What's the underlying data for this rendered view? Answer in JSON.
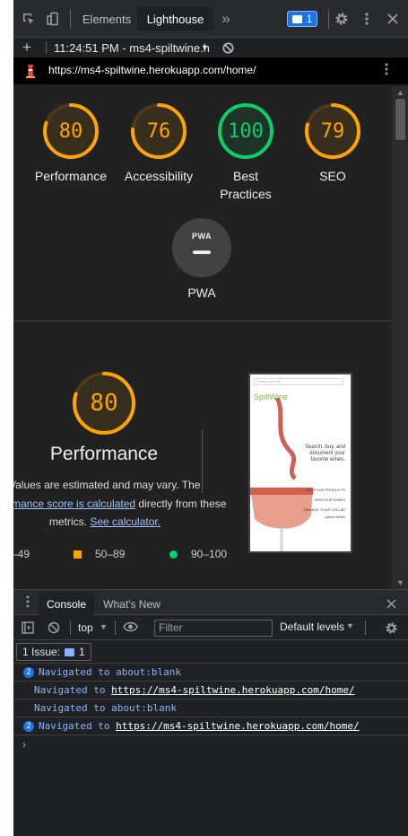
{
  "toolbar": {
    "tabs": [
      "Elements",
      "Lighthouse"
    ],
    "more": "»",
    "message_count": "1"
  },
  "report_bar": {
    "time_label": "11:24:51 PM - ms4-spiltwine.h",
    "dropdown": "▼"
  },
  "url_bar": {
    "url": "https://ms4-spiltwine.herokuapp.com/home/"
  },
  "scores": [
    {
      "label": "Performance",
      "value": "80",
      "score": 80,
      "color": "#ffa400"
    },
    {
      "label": "Accessibility",
      "value": "76",
      "score": 76,
      "color": "#ffa400"
    },
    {
      "label": "Best Practices",
      "value": "100",
      "score": 100,
      "color": "#0cce6b"
    },
    {
      "label": "SEO",
      "value": "79",
      "score": 79,
      "color": "#ffa400"
    }
  ],
  "pwa": {
    "badge": "PWA",
    "label": "PWA"
  },
  "performance": {
    "score": 80,
    "value": "80",
    "title": "Performance",
    "desc_line1": "Values are estimated and may vary. The",
    "desc_link1": "mance score is calculated",
    "desc_line2_rest": " directly from these",
    "desc_line3": "metrics.",
    "desc_link2": "See calculator.",
    "legend": [
      "–49",
      "50–89",
      "90–100"
    ]
  },
  "screenshot": {
    "search_placeholder": "Search our site",
    "brand": "SpiltWine",
    "tagline": "Search, buy, and document your favorite wines.",
    "links": [
      "VIEW OUR PRODUCTS",
      "VIEW OUR WINES",
      "MANAGE YOUR CELLAR",
      "Latest Wines"
    ]
  },
  "drawer": {
    "tabs": [
      "Console",
      "What's New"
    ],
    "context": "top",
    "filter_placeholder": "Filter",
    "levels": "Default levels",
    "issues_label": "1 Issue:",
    "issues_count": "1",
    "logs": [
      {
        "count": "2",
        "text": "Navigated to about:blank",
        "link": ""
      },
      {
        "count": "",
        "text": "Navigated to ",
        "link": "https://ms4-spiltwine.herokuapp.com/home/"
      },
      {
        "count": "",
        "text": "Navigated to about:blank",
        "link": ""
      },
      {
        "count": "2",
        "text": "Navigated to ",
        "link": "https://ms4-spiltwine.herokuapp.com/home/"
      }
    ],
    "prompt": "›"
  },
  "colors": {
    "average": "#ffa400",
    "pass": "#0cce6b",
    "link": "#9ec3ff"
  }
}
